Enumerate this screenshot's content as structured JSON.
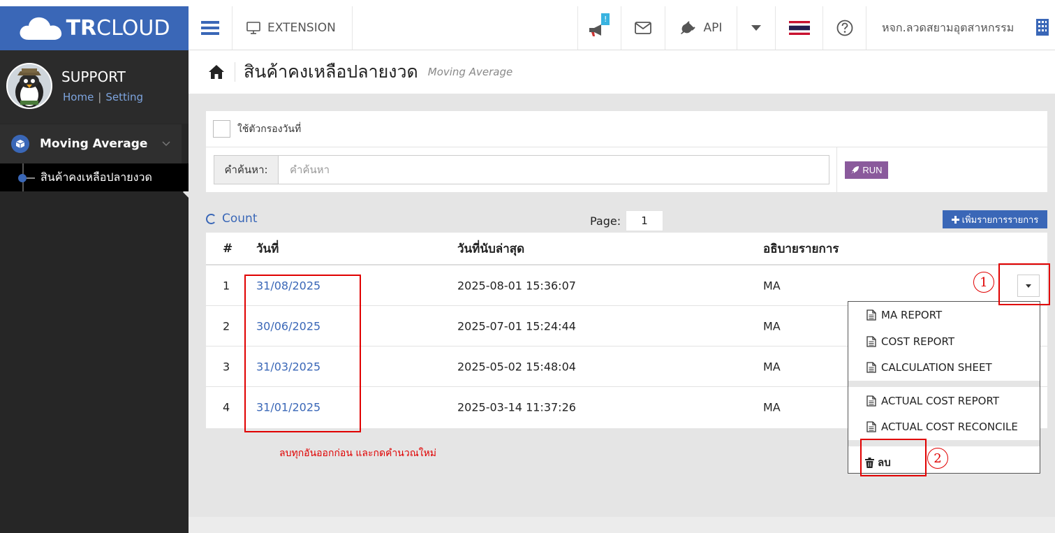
{
  "app": {
    "brand_bold": "TR",
    "brand_rest": "CLOUD"
  },
  "topbar": {
    "extension_label": "EXTENSION",
    "notification_badge": "!",
    "api_label": "API",
    "company_name": "หจก.ลวดสยามอุตสาหกรรม"
  },
  "profile": {
    "name": "SUPPORT",
    "home_link": "Home",
    "separator": "|",
    "setting_link": "Setting"
  },
  "sidebar": {
    "module_label": "Moving Average",
    "submenu_label": "สินค้าคงเหลือปลายงวด"
  },
  "page": {
    "title": "สินค้าคงเหลือปลายงวด",
    "subtitle": "Moving Average"
  },
  "filter": {
    "date_filter_label": "ใช้ตัวกรองวันที่",
    "search_addon": "คำค้นหา:",
    "search_placeholder": "คำค้นหา",
    "run_label": "RUN"
  },
  "list": {
    "count_label": "Count",
    "page_label": "Page:",
    "page_value": "1",
    "add_label": "เพิ่มรายการรายการ"
  },
  "table": {
    "headers": {
      "num": "#",
      "date": "วันที่",
      "last_count": "วันที่นับล่าสุด",
      "description": "อธิบายรายการ"
    },
    "rows": [
      {
        "num": "1",
        "date": "31/08/2025",
        "last_count": "2025-08-01 15:36:07",
        "description": "MA"
      },
      {
        "num": "2",
        "date": "30/06/2025",
        "last_count": "2025-07-01 15:24:44",
        "description": "MA"
      },
      {
        "num": "3",
        "date": "31/03/2025",
        "last_count": "2025-05-02 15:48:04",
        "description": "MA"
      },
      {
        "num": "4",
        "date": "31/01/2025",
        "last_count": "2025-03-14 11:37:26",
        "description": "MA"
      }
    ]
  },
  "dropdown": {
    "items": [
      "MA REPORT",
      "COST REPORT",
      "CALCULATION SHEET",
      "ACTUAL COST REPORT",
      "ACTUAL COST RECONCILE"
    ],
    "delete_label": "ลบ"
  },
  "annotations": {
    "step1": "1",
    "step2": "2",
    "note": "ลบทุกอันออกก่อน และกดคำนวณใหม่"
  },
  "colors": {
    "primary": "#3a67b7",
    "run": "#8a5a9c",
    "annotation": "#e00000"
  }
}
